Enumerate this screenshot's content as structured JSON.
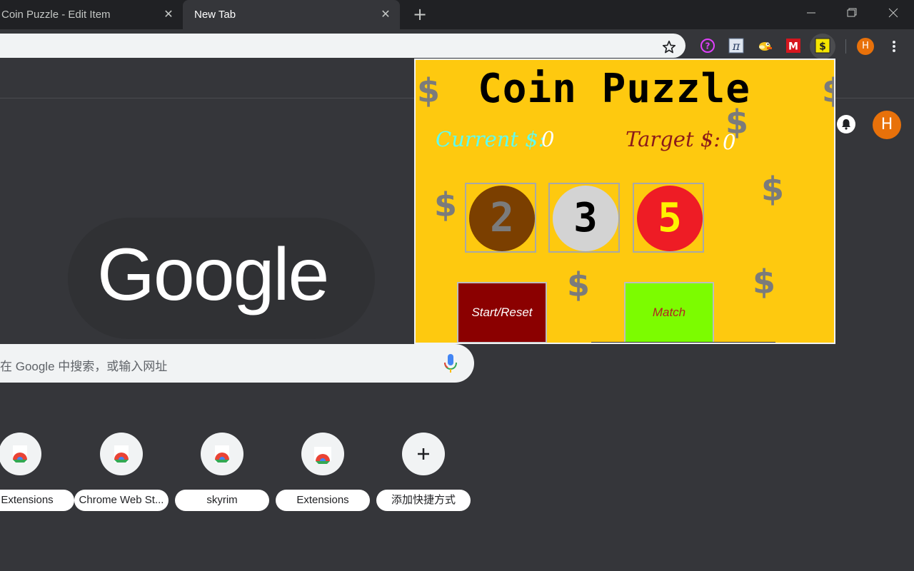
{
  "browser": {
    "tabs": [
      {
        "title": "Coin Puzzle - Edit Item",
        "active": false
      },
      {
        "title": "New Tab",
        "active": true
      }
    ],
    "profile_initial": "H"
  },
  "extensions": [
    "help-circle-icon",
    "pi-icon",
    "flappy-bird-icon",
    "m-logo-icon",
    "dollar-coin-icon"
  ],
  "ntp": {
    "logo_text": "Google",
    "search_placeholder": "在 Google 中搜索，或输入网址",
    "profile_initial": "H",
    "shortcuts": [
      {
        "label": "Extensions",
        "icon": "chrome-icon"
      },
      {
        "label": "Chrome Web St...",
        "icon": "chrome-icon"
      },
      {
        "label": "skyrim",
        "icon": "chrome-icon"
      },
      {
        "label": "Extensions",
        "icon": "chrome-icon"
      },
      {
        "label": "添加快捷方式",
        "icon": "plus-icon"
      }
    ]
  },
  "popup": {
    "title": "Coin Puzzle",
    "current_label": "Current $:",
    "current_value": "0",
    "target_label": "Target $:",
    "target_value": "0",
    "coins": [
      {
        "value": "2",
        "color": "#7b3f00",
        "text_color": "#7b7b7b"
      },
      {
        "value": "3",
        "color": "#d3d3d3",
        "text_color": "#000000"
      },
      {
        "value": "5",
        "color": "#ee1c25",
        "text_color": "#fff200"
      }
    ],
    "start_button": "Start/Reset",
    "match_button": "Match",
    "dollar_symbol": "$"
  },
  "colors": {
    "popup_bg": "#fec90f",
    "current_label": "#5ffbf1",
    "target_label": "#8b1a1a",
    "start_bg": "#8b0000",
    "match_bg": "#7cfc00",
    "match_text": "#b22222"
  }
}
